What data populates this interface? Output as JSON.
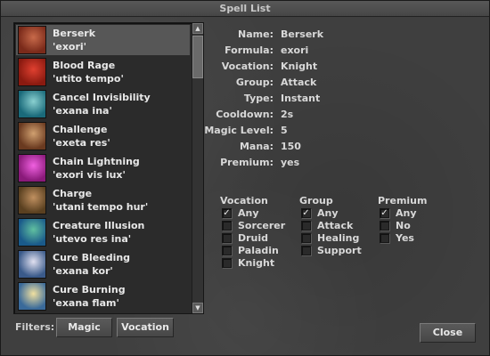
{
  "window": {
    "title": "Spell List"
  },
  "spells": [
    {
      "name": "Berserk",
      "words": "'exori'",
      "icon": "berserker-face-icon",
      "c1": "#7a2a1a",
      "c2": "#c86a4a",
      "selected": true
    },
    {
      "name": "Blood Rage",
      "words": "'utito tempo'",
      "icon": "blood-rage-face-icon",
      "c1": "#8a1a10",
      "c2": "#e04030",
      "selected": false
    },
    {
      "name": "Cancel Invisibility",
      "words": "'exana ina'",
      "icon": "cancel-invisibility-icon",
      "c1": "#1a6a7a",
      "c2": "#8ad0d0",
      "selected": false
    },
    {
      "name": "Challenge",
      "words": "'exeta res'",
      "icon": "challenge-crossed-swords-icon",
      "c1": "#6a3a20",
      "c2": "#d0a070",
      "selected": false
    },
    {
      "name": "Chain Lightning",
      "words": "'exori vis lux'",
      "icon": "chain-lightning-icon",
      "c1": "#8a1a7a",
      "c2": "#f060e0",
      "selected": false
    },
    {
      "name": "Charge",
      "words": "'utani tempo hur'",
      "icon": "charge-face-icon",
      "c1": "#5a4020",
      "c2": "#c09060",
      "selected": false
    },
    {
      "name": "Creature Illusion",
      "words": "'utevo res ina'",
      "icon": "creature-illusion-icon",
      "c1": "#1a5a8a",
      "c2": "#60c0a0",
      "selected": false
    },
    {
      "name": "Cure Bleeding",
      "words": "'exana kor'",
      "icon": "cure-bleeding-icon",
      "c1": "#3a5a8a",
      "c2": "#e0e0f0",
      "selected": false
    },
    {
      "name": "Cure Burning",
      "words": "'exana flam'",
      "icon": "cure-burning-icon",
      "c1": "#3a6a9a",
      "c2": "#f0e0a0",
      "selected": false
    }
  ],
  "filters": {
    "label": "Filters:",
    "magic_button": "Magic",
    "vocation_button": "Vocation"
  },
  "details": [
    {
      "label": "Name:",
      "value": "Berserk"
    },
    {
      "label": "Formula:",
      "value": "exori"
    },
    {
      "label": "Vocation:",
      "value": "Knight"
    },
    {
      "label": "Group:",
      "value": "Attack"
    },
    {
      "label": "Type:",
      "value": "Instant"
    },
    {
      "label": "Cooldown:",
      "value": "2s"
    },
    {
      "label": "Magic Level:",
      "value": "5"
    },
    {
      "label": "Mana:",
      "value": "150"
    },
    {
      "label": "Premium:",
      "value": "yes"
    }
  ],
  "filter_groups": {
    "vocation": {
      "title": "Vocation",
      "options": [
        {
          "label": "Any",
          "checked": true
        },
        {
          "label": "Sorcerer",
          "checked": false
        },
        {
          "label": "Druid",
          "checked": false
        },
        {
          "label": "Paladin",
          "checked": false
        },
        {
          "label": "Knight",
          "checked": false
        }
      ]
    },
    "group": {
      "title": "Group",
      "options": [
        {
          "label": "Any",
          "checked": true
        },
        {
          "label": "Attack",
          "checked": false
        },
        {
          "label": "Healing",
          "checked": false
        },
        {
          "label": "Support",
          "checked": false
        }
      ]
    },
    "premium": {
      "title": "Premium",
      "options": [
        {
          "label": "Any",
          "checked": true
        },
        {
          "label": "No",
          "checked": false
        },
        {
          "label": "Yes",
          "checked": false
        }
      ]
    }
  },
  "buttons": {
    "close": "Close"
  },
  "scrollbar": {
    "up": "▲",
    "down": "▼"
  }
}
